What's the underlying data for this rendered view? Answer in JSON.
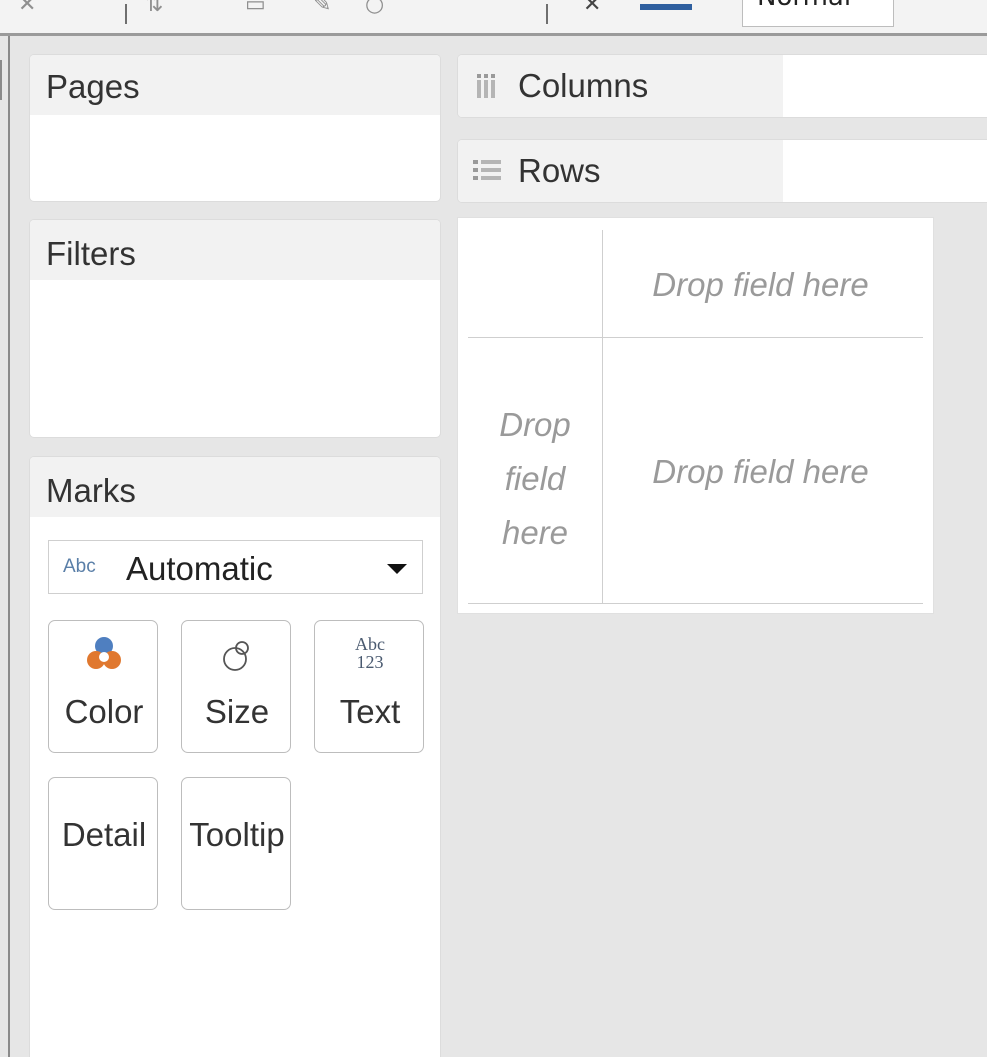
{
  "toolbar": {
    "fit_value": "Normal"
  },
  "sidebar": {
    "pages": {
      "title": "Pages"
    },
    "filters": {
      "title": "Filters"
    },
    "marks": {
      "title": "Marks",
      "mark_type": {
        "abc": "Abc",
        "label": "Automatic"
      },
      "buttons": [
        {
          "label": "Color",
          "icon": "color-circles-icon"
        },
        {
          "label": "Size",
          "icon": "size-circles-icon"
        },
        {
          "label": "Text",
          "icon": "abc-123-icon"
        },
        {
          "label": "Detail",
          "icon": ""
        },
        {
          "label": "Tooltip",
          "icon": ""
        }
      ],
      "text_icon": {
        "top": "Abc",
        "bottom": "123"
      }
    }
  },
  "shelves": {
    "columns": {
      "label": "Columns",
      "icon": "columns-icon"
    },
    "rows": {
      "label": "Rows",
      "icon": "rows-icon"
    }
  },
  "view": {
    "drop_columns": "Drop field here",
    "drop_rows": "Drop field here",
    "drop_body": "Drop field here"
  },
  "colors": {
    "accent_blue": "#4f7fc0",
    "accent_orange": "#e0782f",
    "panel_header": "#f2f2f2",
    "background": "#e6e6e6"
  }
}
